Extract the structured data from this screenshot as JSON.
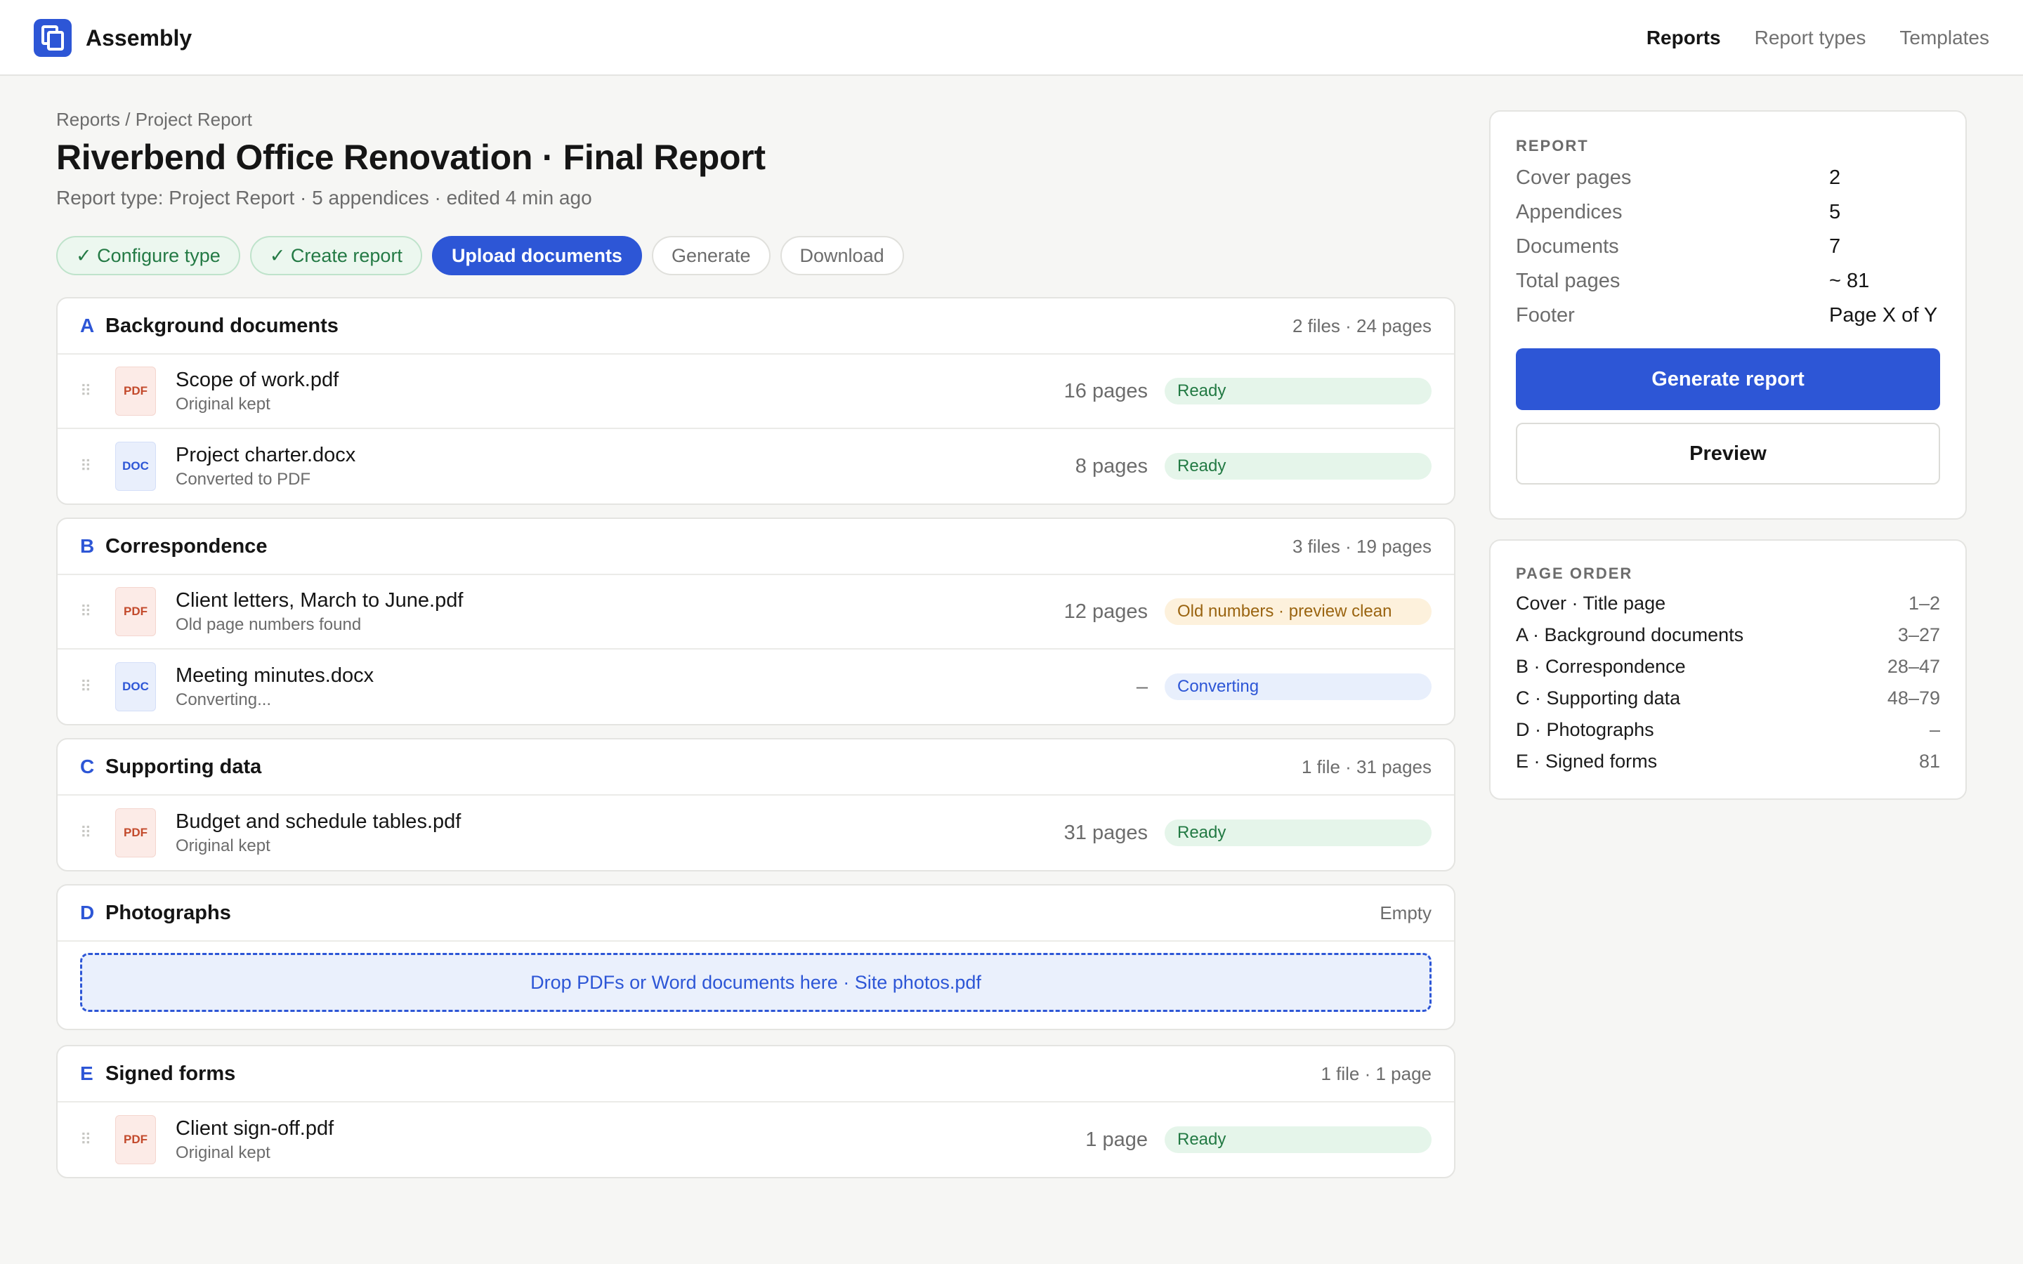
{
  "app": {
    "name": "Assembly"
  },
  "nav": {
    "items": [
      "Reports",
      "Report types",
      "Templates"
    ]
  },
  "header": {
    "breadcrumb": "Reports / Project Report",
    "title": "Riverbend Office Renovation · Final Report",
    "subtitle": "Report type: Project Report · 5 appendices · edited 4 min ago"
  },
  "steps": [
    "✓ Configure type",
    "✓ Create report",
    "Upload documents",
    "Generate",
    "Download"
  ],
  "sections": [
    {
      "letter": "A",
      "title": "Background documents",
      "meta": "2 files · 24 pages",
      "files": [
        {
          "type": "PDF",
          "name": "Scope of work.pdf",
          "note": "Original kept",
          "pages": "16 pages",
          "status": "Ready"
        },
        {
          "type": "DOC",
          "name": "Project charter.docx",
          "note": "Converted to PDF",
          "pages": "8 pages",
          "status": "Ready"
        }
      ]
    },
    {
      "letter": "B",
      "title": "Correspondence",
      "meta": "3 files · 19 pages",
      "files": [
        {
          "type": "PDF",
          "name": "Client letters, March to June.pdf",
          "note": "Old page numbers found",
          "pages": "12 pages",
          "status": "Old numbers · preview clean"
        },
        {
          "type": "DOC",
          "name": "Meeting minutes.docx",
          "note": "Converting...",
          "pages": "–",
          "status": "Converting"
        }
      ]
    },
    {
      "letter": "C",
      "title": "Supporting data",
      "meta": "1 file · 31 pages",
      "files": [
        {
          "type": "PDF",
          "name": "Budget and schedule tables.pdf",
          "note": "Original kept",
          "pages": "31 pages",
          "status": "Ready"
        }
      ]
    },
    {
      "letter": "D",
      "title": "Photographs",
      "meta": "Empty",
      "dropzone": "Drop PDFs or Word documents here · Site photos.pdf"
    },
    {
      "letter": "E",
      "title": "Signed forms",
      "meta": "1 file · 1 page",
      "files": [
        {
          "type": "PDF",
          "name": "Client sign-off.pdf",
          "note": "Original kept",
          "pages": "1 page",
          "status": "Ready"
        }
      ]
    }
  ],
  "report_card": {
    "label": "REPORT",
    "rows": [
      {
        "key": "Cover pages",
        "value": "2"
      },
      {
        "key": "Appendices",
        "value": "5"
      },
      {
        "key": "Documents",
        "value": "7"
      },
      {
        "key": "Total pages",
        "value": "~ 81"
      },
      {
        "key": "Footer",
        "value": "Page X of Y"
      }
    ],
    "primary_button": "Generate report",
    "secondary_button": "Preview"
  },
  "page_order": {
    "label": "PAGE ORDER",
    "rows": [
      {
        "name": "Cover · Title page",
        "range": "1–2"
      },
      {
        "name": "A · Background documents",
        "range": "3–27"
      },
      {
        "name": "B · Correspondence",
        "range": "28–47"
      },
      {
        "name": "C · Supporting data",
        "range": "48–79"
      },
      {
        "name": "D · Photographs",
        "range": "–"
      },
      {
        "name": "E · Signed forms",
        "range": "81"
      }
    ]
  },
  "colors": {
    "accent": "#2d56d6",
    "ready": "#237a44",
    "warning": "#9a6410"
  }
}
